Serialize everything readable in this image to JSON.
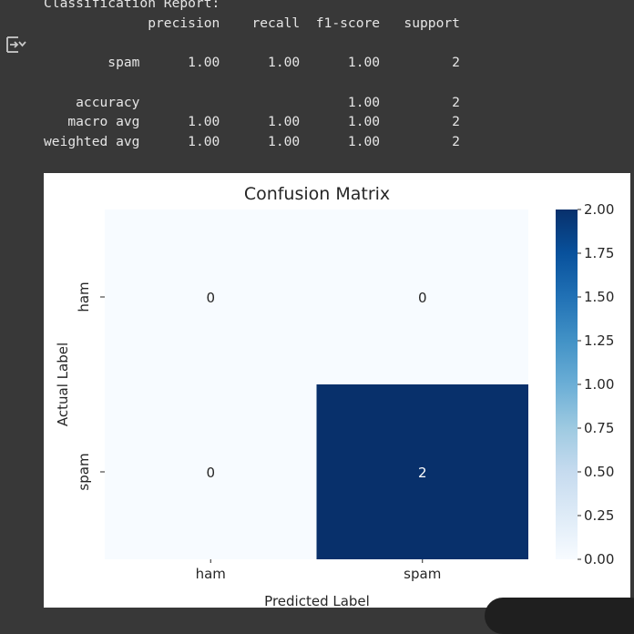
{
  "report": {
    "header": "Classification Report:",
    "columns": [
      "precision",
      "recall",
      "f1-score",
      "support"
    ],
    "rows": [
      {
        "label": "spam",
        "precision": "1.00",
        "recall": "1.00",
        "f1": "1.00",
        "support": "2"
      },
      {
        "label": "accuracy",
        "precision": "",
        "recall": "",
        "f1": "1.00",
        "support": "2"
      },
      {
        "label": "macro avg",
        "precision": "1.00",
        "recall": "1.00",
        "f1": "1.00",
        "support": "2"
      },
      {
        "label": "weighted avg",
        "precision": "1.00",
        "recall": "1.00",
        "f1": "1.00",
        "support": "2"
      }
    ]
  },
  "icons": {
    "output_toggle": "output-toggle-icon"
  },
  "colors": {
    "cell_low": "#f7fbff",
    "cell_high": "#08306b",
    "text_on_low": "#262626",
    "text_on_high": "#ffffff"
  },
  "chart_data": {
    "type": "heatmap",
    "title": "Confusion Matrix",
    "xlabel": "Predicted Label",
    "ylabel": "Actual Label",
    "x_categories": [
      "ham",
      "spam"
    ],
    "y_categories": [
      "ham",
      "spam"
    ],
    "values": [
      [
        0,
        0
      ],
      [
        0,
        2
      ]
    ],
    "colorbar": {
      "range": [
        0,
        2
      ],
      "ticks": [
        "0.00",
        "0.25",
        "0.50",
        "0.75",
        "1.00",
        "1.25",
        "1.50",
        "1.75",
        "2.00"
      ],
      "colormap": "Blues"
    }
  }
}
